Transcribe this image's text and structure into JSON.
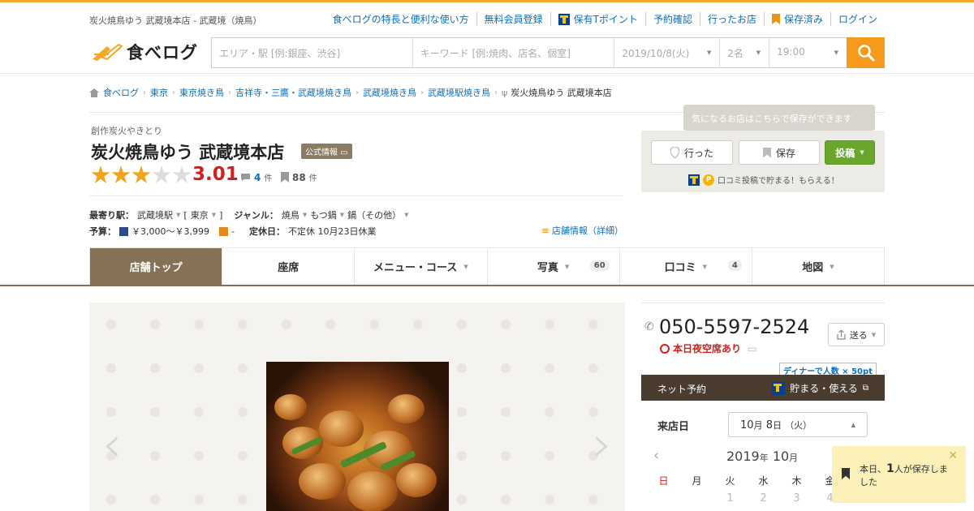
{
  "header": {
    "tagline": "炭火焼鳥ゆう 武蔵境本店 - 武蔵境（焼鳥）",
    "links": {
      "features": "食べログの特長と便利な使い方",
      "register": "無料会員登録",
      "tpoint": "保有Tポイント",
      "reservations": "予約確認",
      "visited": "行ったお店",
      "saved": "保存済み",
      "login": "ログイン"
    },
    "logo_text": "食べログ",
    "search": {
      "area_placeholder": "エリア・駅 [例:銀座、渋谷]",
      "keyword_placeholder": "キーワード [例:焼肉、店名、個室]",
      "date": "2019/10/8(火)",
      "people": "2名",
      "time": "19:00"
    }
  },
  "breadcrumb": {
    "items": [
      "食べログ",
      "東京",
      "東京焼き鳥",
      "吉祥寺・三鷹・武蔵境焼き鳥",
      "武蔵境焼き鳥",
      "武蔵境駅焼き鳥"
    ],
    "current": "炭火焼鳥ゆう 武蔵境本店"
  },
  "store": {
    "subcategory": "創作炭火やきとり",
    "name": "炭火焼鳥ゆう 武蔵境本店",
    "official_badge": "公式情報",
    "rating": "3.01",
    "rating_stars": 3,
    "review_count": "4",
    "review_unit": "件",
    "save_count": "88",
    "save_unit": "件",
    "nearest_label": "最寄り駅：",
    "nearest_station": "武蔵境駅",
    "area_bracket_open": "[",
    "area": "東京",
    "area_bracket_close": "]",
    "genre_label": "ジャンル：",
    "genres": [
      "焼鳥",
      "もつ鍋",
      "鍋（その他）"
    ],
    "budget_label": "予算：",
    "budget_dinner": "￥3,000～￥3,999",
    "budget_lunch": "-",
    "holiday_label": "定休日：",
    "holiday": "不定休 10月23日休業",
    "shop_info_link": "店舗情報（詳細）"
  },
  "save_panel": {
    "tooltip": "気になるお店はこちらで保存ができます",
    "went_label": "行った",
    "save_label": "保存",
    "post_label": "投稿",
    "note": "口コミ投稿で貯まる！もらえる！"
  },
  "tabs": [
    {
      "label": "店舗トップ",
      "count": ""
    },
    {
      "label": "座席",
      "count": ""
    },
    {
      "label": "メニュー・コース",
      "count": ""
    },
    {
      "label": "写真",
      "count": "60"
    },
    {
      "label": "口コミ",
      "count": "4"
    },
    {
      "label": "地図",
      "count": ""
    }
  ],
  "contact": {
    "phone": "050-5597-2524",
    "availability": "本日夜空席あり",
    "send_label": "送る"
  },
  "reservation": {
    "dinner_badge": "ディナーで人数 × 50pt",
    "title": "ネット予約",
    "tpoint_label": "貯まる・使える",
    "visit_label": "来店日",
    "selected_date": {
      "month": "10",
      "month_unit": "月",
      "day": "8",
      "day_unit": "日",
      "weekday": "（火）"
    },
    "calendar": {
      "year": "2019",
      "year_unit": "年",
      "month": "10",
      "month_unit": "月",
      "weekdays": [
        "日",
        "月",
        "火",
        "水",
        "木",
        "金"
      ],
      "first_days": [
        "",
        "",
        "1",
        "2",
        "3",
        "4"
      ]
    }
  },
  "popup": {
    "prefix": "本日、",
    "count": "1",
    "suffix": "人が保存しました"
  },
  "colors": {
    "accent_orange": "#f59a1a",
    "tab_active": "#857255",
    "rating_red": "#d0211c",
    "link_blue": "#0e6fb8",
    "post_green": "#6aa52c"
  }
}
